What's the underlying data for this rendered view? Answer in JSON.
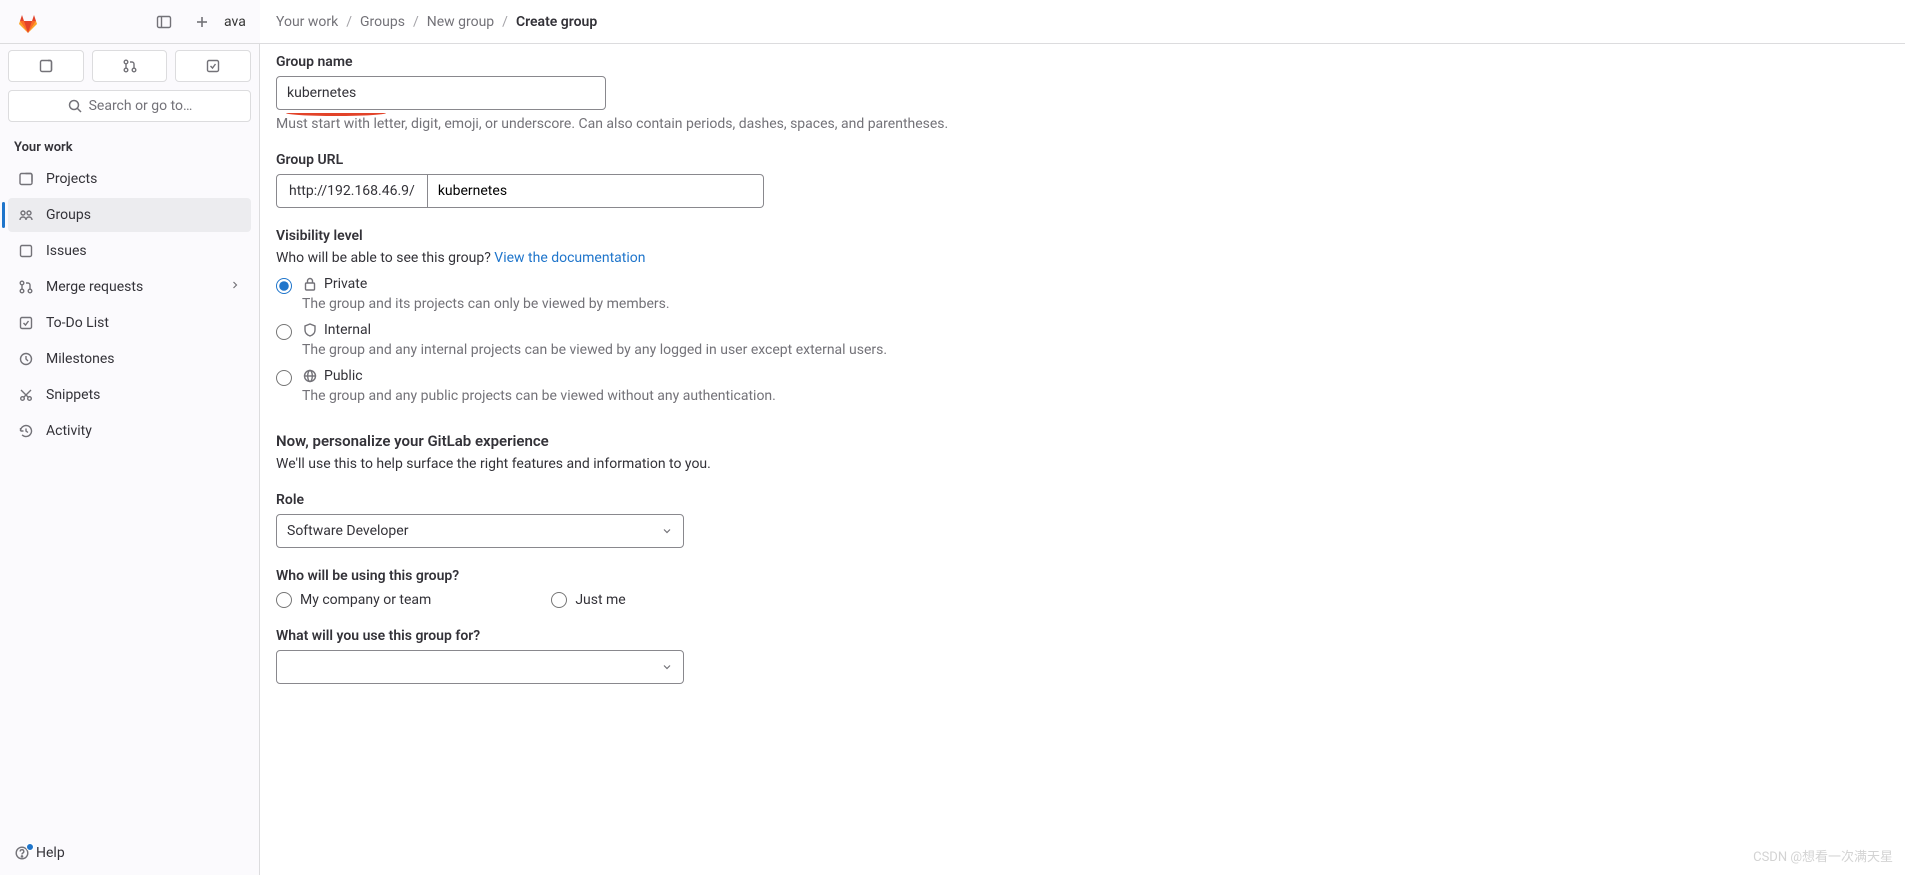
{
  "topbar": {
    "avatar_text": "ava",
    "breadcrumbs": {
      "items": [
        "Your work",
        "Groups",
        "New group"
      ],
      "current": "Create group"
    }
  },
  "sidebar": {
    "search_label": "Search or go to…",
    "section_label": "Your work",
    "items": [
      {
        "label": "Projects"
      },
      {
        "label": "Groups"
      },
      {
        "label": "Issues"
      },
      {
        "label": "Merge requests"
      },
      {
        "label": "To-Do List"
      },
      {
        "label": "Milestones"
      },
      {
        "label": "Snippets"
      },
      {
        "label": "Activity"
      }
    ],
    "help_label": "Help"
  },
  "form": {
    "group_name": {
      "label": "Group name",
      "value": "kubernetes",
      "help": "Must start with letter, digit, emoji, or underscore. Can also contain periods, dashes, spaces, and parentheses."
    },
    "group_url": {
      "label": "Group URL",
      "prefix": "http://192.168.46.9/",
      "value": "kubernetes"
    },
    "visibility": {
      "label": "Visibility level",
      "question": "Who will be able to see this group? ",
      "doc_link": "View the documentation",
      "options": [
        {
          "name": "Private",
          "desc": "The group and its projects can only be viewed by members."
        },
        {
          "name": "Internal",
          "desc": "The group and any internal projects can be viewed by any logged in user except external users."
        },
        {
          "name": "Public",
          "desc": "The group and any public projects can be viewed without any authentication."
        }
      ]
    },
    "personalize": {
      "heading": "Now, personalize your GitLab experience",
      "sub": "We'll use this to help surface the right features and information to you."
    },
    "role": {
      "label": "Role",
      "value": "Software Developer"
    },
    "who_using": {
      "label": "Who will be using this group?",
      "options": [
        "My company or team",
        "Just me"
      ]
    },
    "what_for": {
      "label": "What will you use this group for?",
      "value": ""
    }
  },
  "watermark": "CSDN @想看一次满天星"
}
